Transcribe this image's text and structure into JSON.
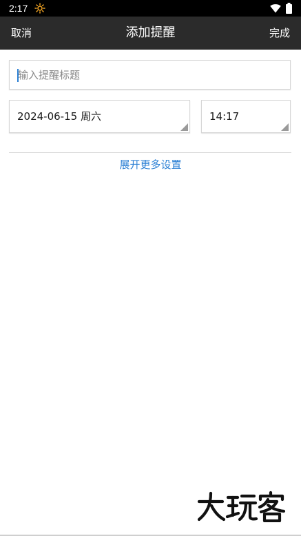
{
  "status_bar": {
    "time": "2:17",
    "icons": [
      "sun-icon",
      "wifi-icon",
      "battery-icon"
    ]
  },
  "header": {
    "cancel_label": "取消",
    "title": "添加提醒",
    "done_label": "完成"
  },
  "form": {
    "title_placeholder": "输入提醒标题",
    "date_value": "2024-06-15 周六",
    "time_value": "14:17"
  },
  "more_settings_label": "展开更多设置",
  "watermark": {
    "text": "大玩客"
  },
  "colors": {
    "status_bar_bg": "#000000",
    "header_bg": "#2b2b2b",
    "accent": "#2a7fd4",
    "text_primary": "#1a1a1a",
    "placeholder": "#8a8a8a",
    "border": "#d6d6d6"
  }
}
